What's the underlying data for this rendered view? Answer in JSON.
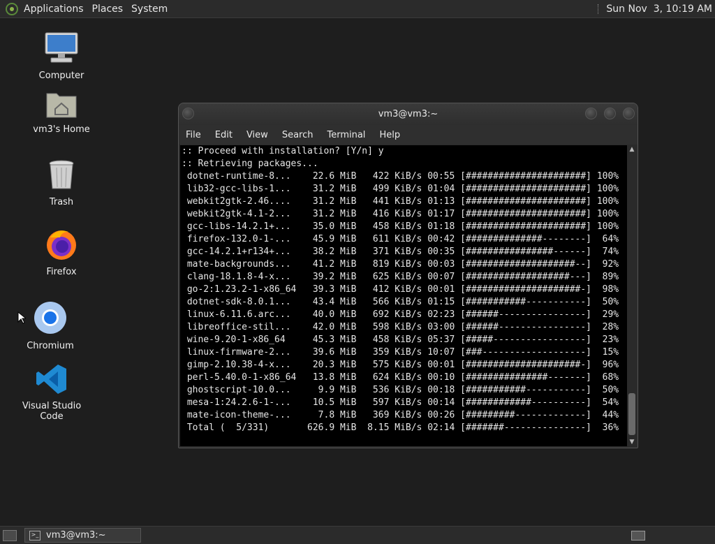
{
  "top_panel": {
    "menus": [
      "Applications",
      "Places",
      "System"
    ],
    "clock": "Sun Nov  3, 10:19 AM"
  },
  "desktop": {
    "icons": [
      {
        "label": "Computer",
        "icon": "computer-icon"
      },
      {
        "label": "vm3's Home",
        "icon": "home-folder-icon"
      },
      {
        "label": "Trash",
        "icon": "trash-icon"
      },
      {
        "label": "Firefox",
        "icon": "firefox-icon"
      },
      {
        "label": "Chromium",
        "icon": "chromium-icon"
      },
      {
        "label": "Visual Studio Code",
        "icon": "vscode-icon"
      }
    ]
  },
  "terminal": {
    "title": "vm3@vm3:~",
    "menu": [
      "File",
      "Edit",
      "View",
      "Search",
      "Terminal",
      "Help"
    ],
    "lines": [
      ":: Proceed with installation? [Y/n] y",
      ":: Retrieving packages...",
      " dotnet-runtime-8...    22.6 MiB   422 KiB/s 00:55 [######################] 100%",
      " lib32-gcc-libs-1...    31.2 MiB   499 KiB/s 01:04 [######################] 100%",
      " webkit2gtk-2.46....    31.2 MiB   441 KiB/s 01:13 [######################] 100%",
      " webkit2gtk-4.1-2...    31.2 MiB   416 KiB/s 01:17 [######################] 100%",
      " gcc-libs-14.2.1+...    35.0 MiB   458 KiB/s 01:18 [######################] 100%",
      " firefox-132.0-1-...    45.9 MiB   611 KiB/s 00:42 [##############--------]  64%",
      " gcc-14.2.1+r134+...    38.2 MiB   371 KiB/s 00:35 [################------]  74%",
      " mate-backgrounds...    41.2 MiB   819 KiB/s 00:03 [####################--]  92%",
      " clang-18.1.8-4-x...    39.2 MiB   625 KiB/s 00:07 [###################---]  89%",
      " go-2:1.23.2-1-x86_64   39.3 MiB   412 KiB/s 00:01 [#####################-]  98%",
      " dotnet-sdk-8.0.1...    43.4 MiB   566 KiB/s 01:15 [###########-----------]  50%",
      " linux-6.11.6.arc...    40.0 MiB   692 KiB/s 02:23 [######----------------]  29%",
      " libreoffice-stil...    42.0 MiB   598 KiB/s 03:00 [######----------------]  28%",
      " wine-9.20-1-x86_64     45.3 MiB   458 KiB/s 05:37 [#####-----------------]  23%",
      " linux-firmware-2...    39.6 MiB   359 KiB/s 10:07 [###-------------------]  15%",
      " gimp-2.10.38-4-x...    20.3 MiB   575 KiB/s 00:01 [#####################-]  96%",
      " perl-5.40.0-1-x86_64   13.8 MiB   624 KiB/s 00:10 [###############-------]  68%",
      " ghostscript-10.0...     9.9 MiB   536 KiB/s 00:18 [###########-----------]  50%",
      " mesa-1:24.2.6-1-...    10.5 MiB   597 KiB/s 00:14 [############----------]  54%",
      " mate-icon-theme-...     7.8 MiB   369 KiB/s 00:26 [#########-------------]  44%",
      " Total (  5/331)       626.9 MiB  8.15 MiB/s 02:14 [#######---------------]  36%"
    ]
  },
  "bottom_panel": {
    "task_label": "vm3@vm3:~"
  }
}
